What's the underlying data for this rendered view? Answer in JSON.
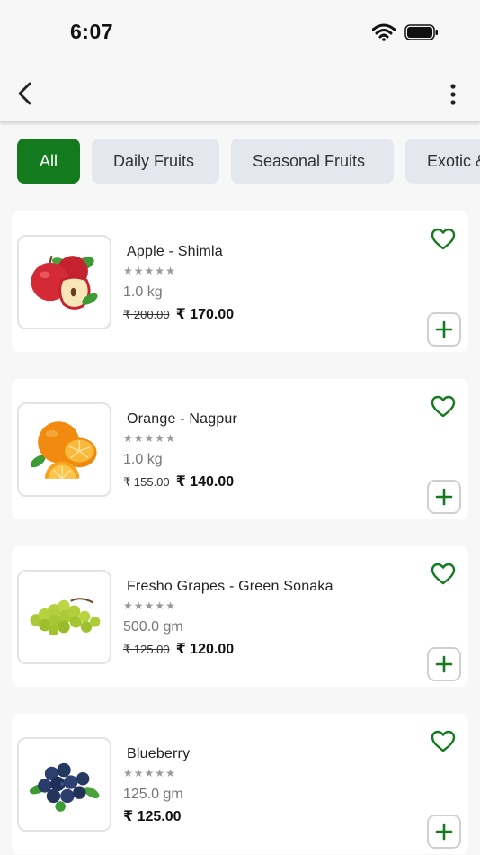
{
  "status_bar": {
    "time": "6:07",
    "wifi_icon": "wifi-icon",
    "battery_icon": "battery-icon"
  },
  "app_bar": {
    "back_icon": "chevron-left-icon",
    "menu_icon": "more-vertical-icon"
  },
  "tabs": [
    {
      "label": "All",
      "active": true
    },
    {
      "label": "Daily Fruits",
      "active": false
    },
    {
      "label": "Seasonal Fruits",
      "active": false
    },
    {
      "label": "Exotic & ...",
      "active": false
    }
  ],
  "products": [
    {
      "name": "Apple - Shimla",
      "rating": 0,
      "quantity": "1.0 kg",
      "mrp": "₹ 200.00",
      "price": "₹ 170.00",
      "image": "apple"
    },
    {
      "name": "Orange - Nagpur",
      "rating": 0,
      "quantity": "1.0 kg",
      "mrp": "₹ 155.00",
      "price": "₹ 140.00",
      "image": "orange"
    },
    {
      "name": "Fresho Grapes - Green Sonaka",
      "rating": 0,
      "quantity": "500.0 gm",
      "mrp": "₹ 125.00",
      "price": "₹ 120.00",
      "image": "grapes"
    },
    {
      "name": "Blueberry",
      "rating": 0,
      "quantity": "125.0 gm",
      "mrp": "",
      "price": "₹ 125.00",
      "image": "blueberry"
    }
  ],
  "colors": {
    "accent": "#137a1e",
    "chip_bg": "#e4e8ee",
    "star": "#9a9a9a"
  }
}
